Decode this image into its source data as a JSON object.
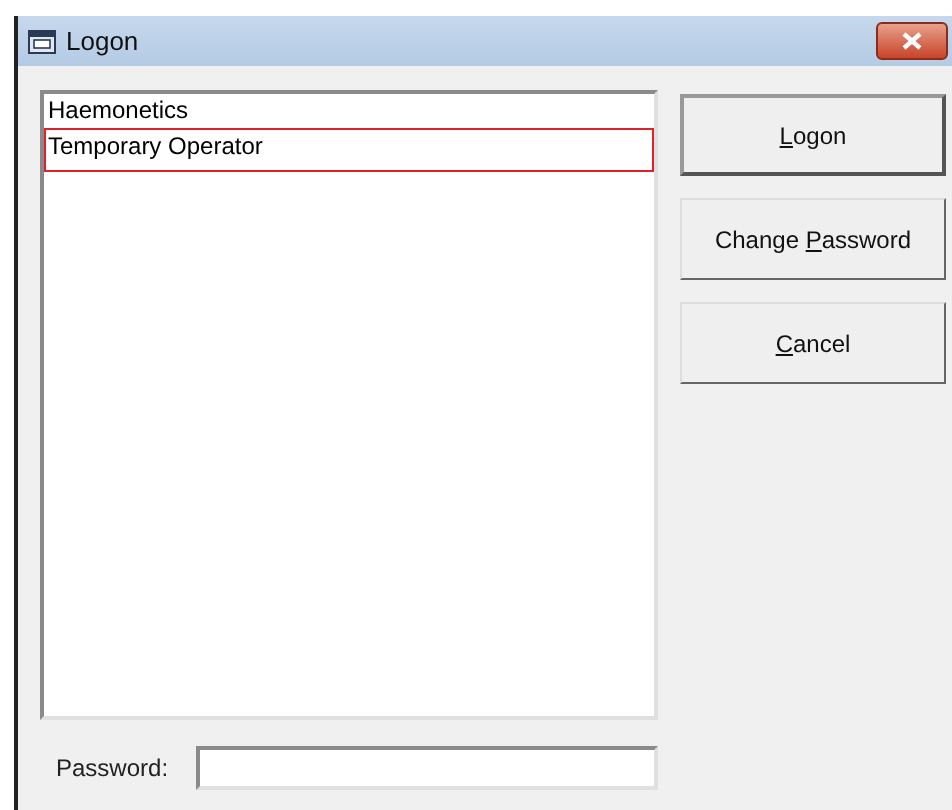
{
  "window": {
    "title": "Logon"
  },
  "users": [
    {
      "name": "Haemonetics",
      "selected": false
    },
    {
      "name": "Temporary Operator",
      "selected": true
    }
  ],
  "buttons": [
    {
      "key": "L",
      "post": "ogon",
      "default": true
    },
    {
      "pre": "Change ",
      "key": "P",
      "post": "assword",
      "default": false
    },
    {
      "key": "C",
      "post": "ancel",
      "default": false
    }
  ],
  "password": {
    "label": "Password:"
  }
}
